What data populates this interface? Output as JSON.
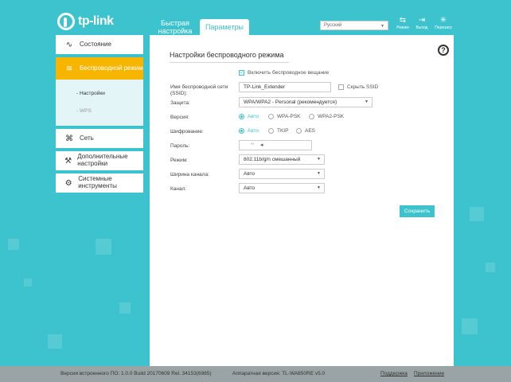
{
  "brand": {
    "logo_text": "tp-link"
  },
  "tabs": {
    "quick": "Быстрая настройка",
    "params": "Параметры"
  },
  "header": {
    "language": "Русский",
    "icons": [
      {
        "name": "reboot-icon",
        "label": "Режим"
      },
      {
        "name": "logout-icon",
        "label": "Выход"
      },
      {
        "name": "restart-icon",
        "label": "Перезагр"
      }
    ]
  },
  "sidebar": {
    "items": [
      {
        "label": "Состояние",
        "icon": "pulse-icon"
      },
      {
        "label": "Беспроводной режим",
        "icon": "wifi-icon"
      },
      {
        "label": "Сеть",
        "icon": "network-icon"
      },
      {
        "label": "Дополнительные настройки",
        "icon": "wrench-icon"
      },
      {
        "label": "Системные инструменты",
        "icon": "tools-icon"
      }
    ],
    "sub": [
      {
        "label": "- Настройки"
      },
      {
        "label": "- WPS"
      }
    ]
  },
  "panel": {
    "title": "Настройки беспроводного режима",
    "enable_wireless": "Включить беспроводное вещание",
    "ssid_label": "Имя беспроводной сети (SSID):",
    "ssid_value": "TP-Link_Extender",
    "hide_ssid": "Скрыть SSID",
    "security_label": "Защита:",
    "security_value": "WPA/WPA2 - Personal (рекомендуется)",
    "version_label": "Версия:",
    "version_options": [
      "Авто",
      "WPA-PSK",
      "WPA2-PSK"
    ],
    "encryption_label": "Шифрование:",
    "encryption_options": [
      "Авто",
      "TKIP",
      "AES"
    ],
    "password_label": "Пароль:",
    "password_value": "",
    "mode_label": "Режим:",
    "mode_value": "802.11b/g/n смешанный",
    "width_label": "Ширина канала:",
    "width_value": "Авто",
    "channel_label": "Канал:",
    "channel_value": "Авто",
    "save": "Сохранить"
  },
  "footer": {
    "firmware": "Версия встроенного ПО: 1.0.0 Build 20170609 Rel. 34153(6985)",
    "hardware": "Аппаратная версия: TL-WA850RE v5.0",
    "support": "Поддержка",
    "app": "Приложение"
  },
  "colors": {
    "accent": "#3cc3cd",
    "active": "#f7b500",
    "background": "#3cc3cd"
  }
}
